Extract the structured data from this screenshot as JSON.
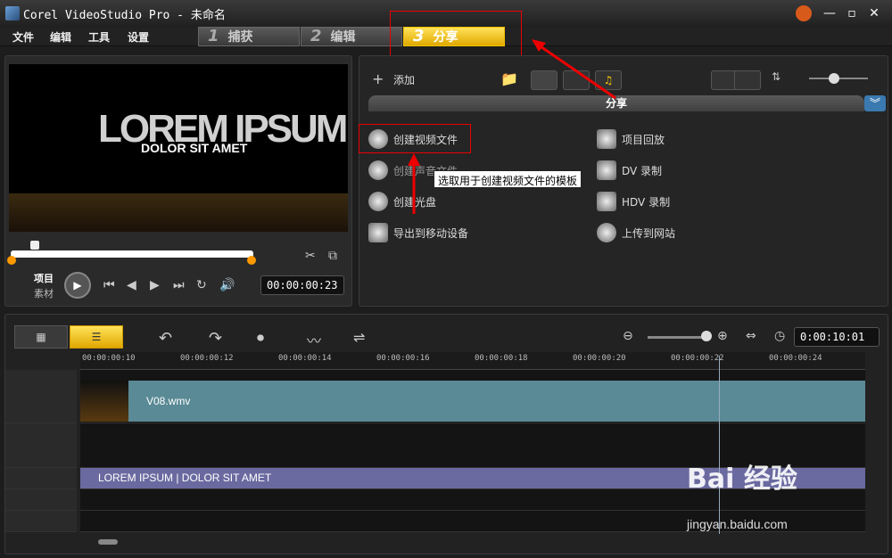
{
  "window": {
    "title": "Corel VideoStudio Pro - 未命名"
  },
  "menu": [
    "文件",
    "编辑",
    "工具",
    "设置"
  ],
  "steps": [
    {
      "num": "1",
      "label": "捕获"
    },
    {
      "num": "2",
      "label": "编辑"
    },
    {
      "num": "3",
      "label": "分享"
    }
  ],
  "preview": {
    "title_text": "LOREM IPSUM",
    "subtitle_text": "DOLOR SIT AMET",
    "mode_project": "项目",
    "mode_clip": "素材",
    "timecode": "00:00:00:23"
  },
  "library": {
    "add_label": "添加",
    "panel_title": "分享",
    "items_left": [
      "创建视频文件",
      "创建声音文件",
      "创建光盘",
      "导出到移动设备"
    ],
    "items_right": [
      "项目回放",
      "DV 录制",
      "HDV 录制",
      "上传到网站"
    ],
    "tooltip": "选取用于创建视频文件的模板"
  },
  "timeline": {
    "duration": "0:00:10:01",
    "ticks": [
      "00:00:00:10",
      "00:00:00:12",
      "00:00:00:14",
      "00:00:00:16",
      "00:00:00:18",
      "00:00:00:20",
      "00:00:00:22",
      "00:00:00:24"
    ],
    "video_clip": "V08.wmv",
    "title_clip": "LOREM IPSUM | DOLOR SIT AMET"
  },
  "watermark": {
    "brand": "Bai 经验",
    "url": "jingyan.baidu.com"
  }
}
